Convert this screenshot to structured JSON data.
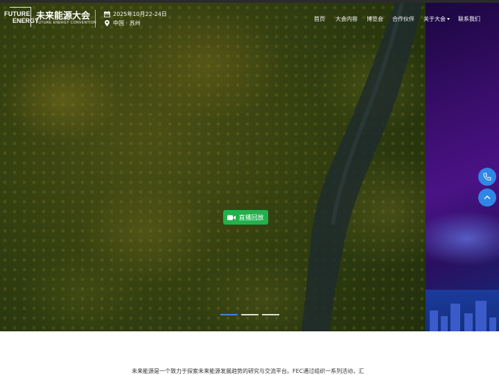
{
  "header": {
    "logo": {
      "en_line1": "FUTURE",
      "en_line2": "ENERGY",
      "cn_title": "未来能源大会",
      "en_subtitle": "FUTURE ENERGY CONVENTION"
    },
    "event": {
      "date": "2025年10月22-24日",
      "location": "中国 · 苏州",
      "date_icon": "calendar-icon",
      "location_icon": "map-pin-icon"
    },
    "nav": [
      {
        "label": "首页"
      },
      {
        "label": "大会内容"
      },
      {
        "label": "博览会"
      },
      {
        "label": "合作伙伴"
      },
      {
        "label": "关于大会",
        "dropdown": true
      },
      {
        "label": "联系我们"
      }
    ]
  },
  "hero": {
    "replay_label": "直播回放",
    "replay_icon": "video-camera-icon",
    "slides": [
      {
        "active": true
      },
      {
        "active": false
      },
      {
        "active": false
      }
    ],
    "accent_green": "#22b14c"
  },
  "side_buttons": [
    {
      "icon": "phone-icon"
    },
    {
      "icon": "chevron-up-icon"
    }
  ],
  "intro_text": "未来能源是一个致力于探索未来能源发展趋势的研究与交流平台。FEC通过组织一系列活动，汇",
  "colors": {
    "side_button_blue": "#2f86e6",
    "active_dot": "#3a8ae0"
  }
}
